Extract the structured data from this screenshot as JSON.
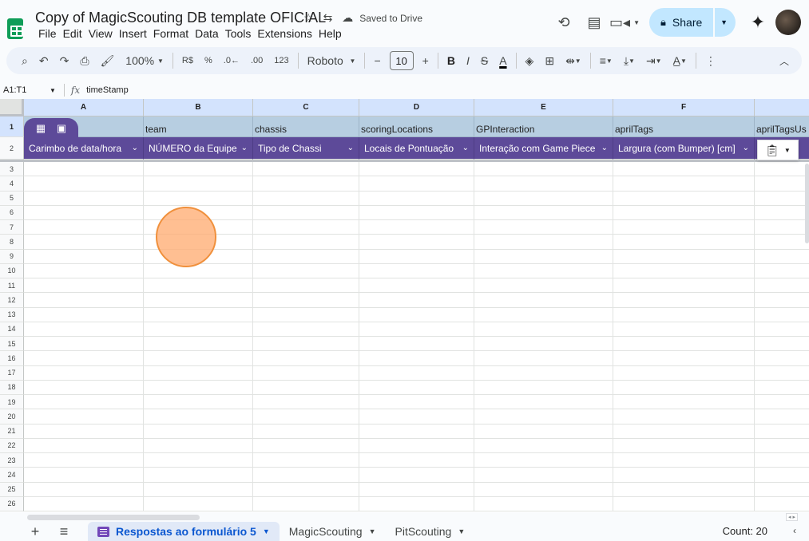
{
  "document": {
    "title": "Copy of MagicScouting DB template OFICIAL",
    "saved_status": "Saved to Drive"
  },
  "menu": [
    "File",
    "Edit",
    "View",
    "Insert",
    "Format",
    "Data",
    "Tools",
    "Extensions",
    "Help"
  ],
  "header_actions": {
    "share_label": "Share"
  },
  "toolbar": {
    "zoom": "100%",
    "currency": "R$",
    "percent": "%",
    "decrease_decimals": ".0←",
    "increase_decimals": ".00",
    "number_format": "123",
    "font": "Roboto",
    "font_size": "10",
    "bold": "B",
    "italic": "I",
    "strikethrough": "S",
    "text_color": "A"
  },
  "formula_bar": {
    "name_box": "A1:T1",
    "fx": "fx",
    "formula": "timeStamp"
  },
  "columns": [
    "A",
    "B",
    "C",
    "D",
    "E",
    "F"
  ],
  "row1_values": [
    "",
    "team",
    "chassis",
    "scoringLocations",
    "GPInteraction",
    "aprilTags",
    "aprilTagsUs"
  ],
  "row2_headers": [
    "Carimbo de data/hora",
    "NÚMERO da Equipe",
    "Tipo de Chassi",
    "Locais de Pontuação",
    "Interação com Game Piece",
    "Largura (com Bumper) [cm]"
  ],
  "row_numbers": [
    "1",
    "2",
    "3",
    "4",
    "5",
    "6",
    "7",
    "8",
    "9",
    "10",
    "11",
    "12",
    "13",
    "14",
    "15",
    "16",
    "17",
    "18",
    "19",
    "20",
    "21",
    "22",
    "23",
    "24",
    "25",
    "26"
  ],
  "sheet_tabs": [
    {
      "label": "Respostas ao formulário 5",
      "active": true
    },
    {
      "label": "MagicScouting",
      "active": false
    },
    {
      "label": "PitScouting",
      "active": false
    }
  ],
  "status": {
    "count": "Count: 20"
  },
  "colors": {
    "table_header_purple": "#5d4a99",
    "row1_blue": "#b7cee1",
    "share_blue": "#c2e7ff",
    "click_indicator": "#ffaa6e"
  }
}
